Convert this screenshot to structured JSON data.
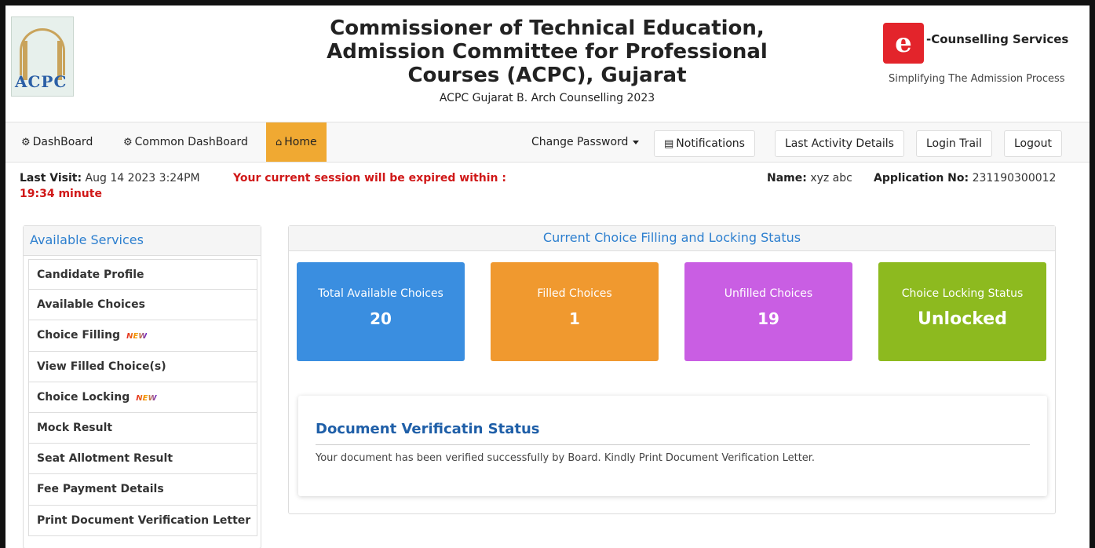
{
  "header": {
    "logo_text": "ACPC",
    "title_line1": "Commissioner of Technical Education,",
    "title_line2": "Admission Committee for Professional",
    "title_line3": "Courses (ACPC), Gujarat",
    "subtitle": "ACPC Gujarat B. Arch Counselling 2023",
    "ecs_name": "-Counselling Services",
    "ecs_tagline": "Simplifying The Admission Process"
  },
  "nav": {
    "dashboard": "DashBoard",
    "common_dashboard": "Common DashBoard",
    "home": "Home",
    "change_password": "Change Password",
    "notifications": "Notifications",
    "last_activity": "Last Activity Details",
    "login_trail": "Login Trail",
    "logout": "Logout"
  },
  "info": {
    "last_visit_label": "Last Visit:",
    "last_visit_value": "Aug 14 2023 3:24PM",
    "session_timer": "19:34 minute",
    "session_msg": "Your current session will be expired within :",
    "name_label": "Name:",
    "name_value": "xyz abc",
    "app_label": "Application No:",
    "app_value": "231190300012"
  },
  "services": {
    "title": "Available Services",
    "new_badge": "NEW",
    "items": [
      {
        "label": "Candidate Profile"
      },
      {
        "label": "Available Choices"
      },
      {
        "label": "Choice Filling"
      },
      {
        "label": "View Filled Choice(s)"
      },
      {
        "label": "Choice Locking"
      },
      {
        "label": "Mock Result"
      },
      {
        "label": "Seat Allotment Result"
      },
      {
        "label": "Fee Payment Details"
      },
      {
        "label": "Print Document Verification Letter"
      }
    ]
  },
  "status": {
    "title": "Current Choice Filling and Locking Status",
    "cards": [
      {
        "label": "Total Available Choices",
        "value": "20",
        "color": "#3a8ee0"
      },
      {
        "label": "Filled Choices",
        "value": "1",
        "color": "#f0992f"
      },
      {
        "label": "Unfilled Choices",
        "value": "19",
        "color": "#c95ee3"
      },
      {
        "label": "Choice Locking Status",
        "value": "Unlocked",
        "color": "#8dba1f"
      }
    ]
  },
  "doc": {
    "title": "Document Verificatin Status",
    "message": "Your document has been verified successfully by Board. Kindly Print Document Verification Letter."
  }
}
